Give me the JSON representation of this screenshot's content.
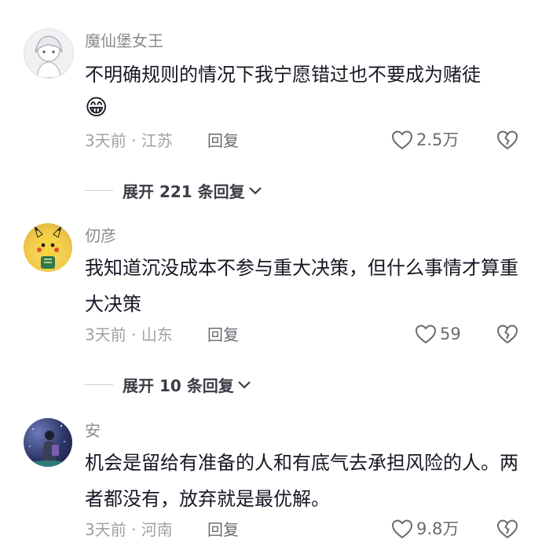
{
  "comments": [
    {
      "username": "魔仙堡女王",
      "text": "不明确规则的情况下我宁愿错过也不要成为赌徒",
      "emoji": "😁",
      "meta": "3天前 · 江苏",
      "reply": "回复",
      "likes": "2.5万",
      "expand": "展开 221 条回复"
    },
    {
      "username": "仞彦",
      "text": "我知道沉没成本不参与重大决策，但什么事情才算重大决策",
      "meta": "3天前 · 山东",
      "reply": "回复",
      "likes": "59",
      "expand": "展开 10 条回复"
    },
    {
      "username": "安",
      "text": "机会是留给有准备的人和有底气去承担风险的人。两者都没有，放弃就是最优解。",
      "meta": "3天前 · 河南",
      "reply": "回复",
      "likes": "9.8万"
    }
  ],
  "colors": {
    "text": "#161823",
    "secondary": "#8a8b91",
    "meta": "#a0a1a6"
  },
  "icons": [
    "heart-icon",
    "broken-heart-icon",
    "chevron-down-icon"
  ]
}
